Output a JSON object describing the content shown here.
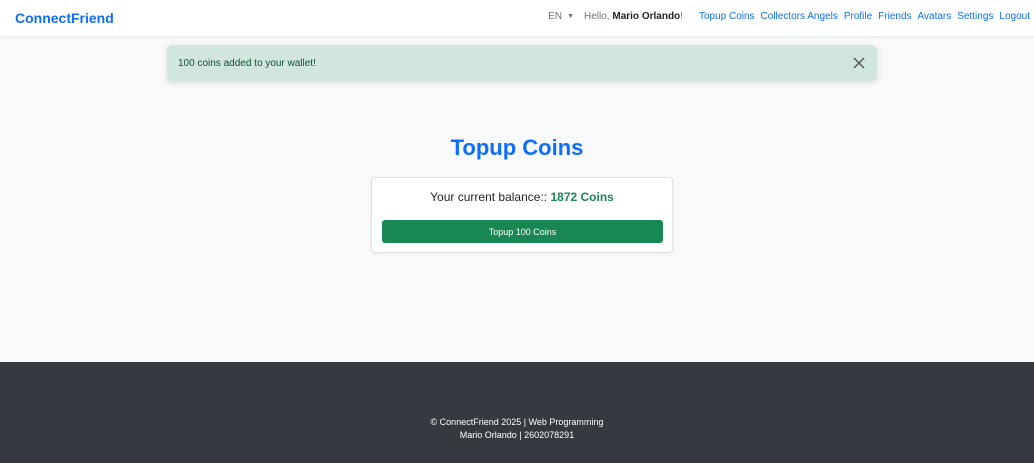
{
  "navbar": {
    "brand": "ConnectFriend",
    "language": "EN",
    "greeting_prefix": "Hello, ",
    "user_name": "Mario Orlando",
    "greeting_suffix": "!",
    "links": [
      "Topup Coins",
      "Collectors Angels",
      "Profile",
      "Friends",
      "Avatars",
      "Settings",
      "Logout"
    ]
  },
  "alert": {
    "message": "100 coins added to your wallet!"
  },
  "main": {
    "title": "Topup Coins",
    "balance_label": "Your current balance:: ",
    "balance_value": "1872 Coins",
    "topup_button": "Topup 100 Coins"
  },
  "footer": {
    "line1": "© ConnectFriend 2025 | Web Programming",
    "line2": "Mario Orlando | 2602078291"
  },
  "colors": {
    "primary": "#0d6efd",
    "success": "#198754",
    "alert_bg": "#d1e7dd",
    "footer_bg": "#343a40"
  }
}
